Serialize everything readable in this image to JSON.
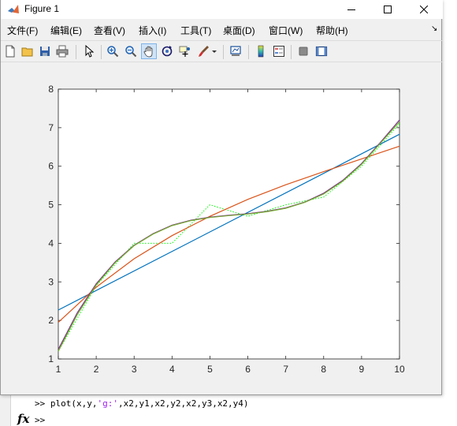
{
  "window": {
    "title": "Figure 1",
    "menus": [
      "文件(F)",
      "编辑(E)",
      "查看(V)",
      "插入(I)",
      "工具(T)",
      "桌面(D)",
      "窗口(W)",
      "帮助(H)"
    ]
  },
  "toolbar": {
    "icons": [
      "new-figure-icon",
      "open-file-icon",
      "save-icon",
      "print-icon",
      "pointer-icon",
      "zoom-in-icon",
      "zoom-out-icon",
      "pan-hand-icon",
      "rotate-3d-icon",
      "data-cursor-icon",
      "brush-icon",
      "link-plot-icon",
      "colorbar-icon",
      "legend-icon",
      "hide-plot-tools-icon",
      "show-plot-tools-icon"
    ]
  },
  "command_window": {
    "line1_prefix": ">> plot(x,y,",
    "line1_string": "'g:'",
    "line1_suffix": ",x2,y1,x2,y2,x2,y3,x2,y4)",
    "prompt": ">>",
    "fx": "fx"
  },
  "chart_data": {
    "type": "line",
    "xlim": [
      1,
      10
    ],
    "ylim": [
      1,
      8
    ],
    "xticks": [
      1,
      2,
      3,
      4,
      5,
      6,
      7,
      8,
      9,
      10
    ],
    "yticks": [
      1,
      2,
      3,
      4,
      5,
      6,
      7,
      8
    ],
    "grid": false,
    "series": [
      {
        "style": "g:",
        "color": "#00ff00",
        "dashed": true,
        "x": [
          1,
          2,
          3,
          4,
          5,
          6,
          7,
          8,
          9,
          10
        ],
        "y": [
          1.2,
          2.9,
          4.0,
          4.0,
          5.0,
          4.7,
          5.0,
          5.2,
          6.0,
          7.1
        ]
      },
      {
        "color": "#0072bd",
        "x": [
          1,
          10
        ],
        "y": [
          2.27,
          6.83
        ]
      },
      {
        "color": "#d95319",
        "x": [
          1,
          2,
          3,
          4,
          5,
          6,
          7,
          8,
          9,
          10
        ],
        "y": [
          1.95,
          2.86,
          3.6,
          4.2,
          4.7,
          5.14,
          5.52,
          5.86,
          6.19,
          6.52
        ]
      },
      {
        "color": "#7e2f8e",
        "x": [
          1,
          1.5,
          2,
          2.5,
          3,
          3.5,
          4,
          4.5,
          5,
          5.5,
          6,
          6.5,
          7,
          7.5,
          8,
          8.5,
          9,
          9.5,
          10
        ],
        "y": [
          1.25,
          2.2,
          2.95,
          3.52,
          3.95,
          4.25,
          4.47,
          4.6,
          4.68,
          4.73,
          4.77,
          4.83,
          4.92,
          5.07,
          5.3,
          5.63,
          6.07,
          6.62,
          7.2
        ]
      },
      {
        "color": "#77ac30",
        "x": [
          1,
          1.5,
          2,
          2.5,
          3,
          3.5,
          4,
          4.5,
          5,
          5.5,
          6,
          6.5,
          7,
          7.5,
          8,
          8.5,
          9,
          9.5,
          10
        ],
        "y": [
          1.2,
          2.15,
          2.92,
          3.5,
          3.94,
          4.24,
          4.46,
          4.59,
          4.67,
          4.72,
          4.76,
          4.82,
          4.91,
          5.06,
          5.28,
          5.61,
          6.05,
          6.6,
          7.15
        ]
      }
    ]
  }
}
